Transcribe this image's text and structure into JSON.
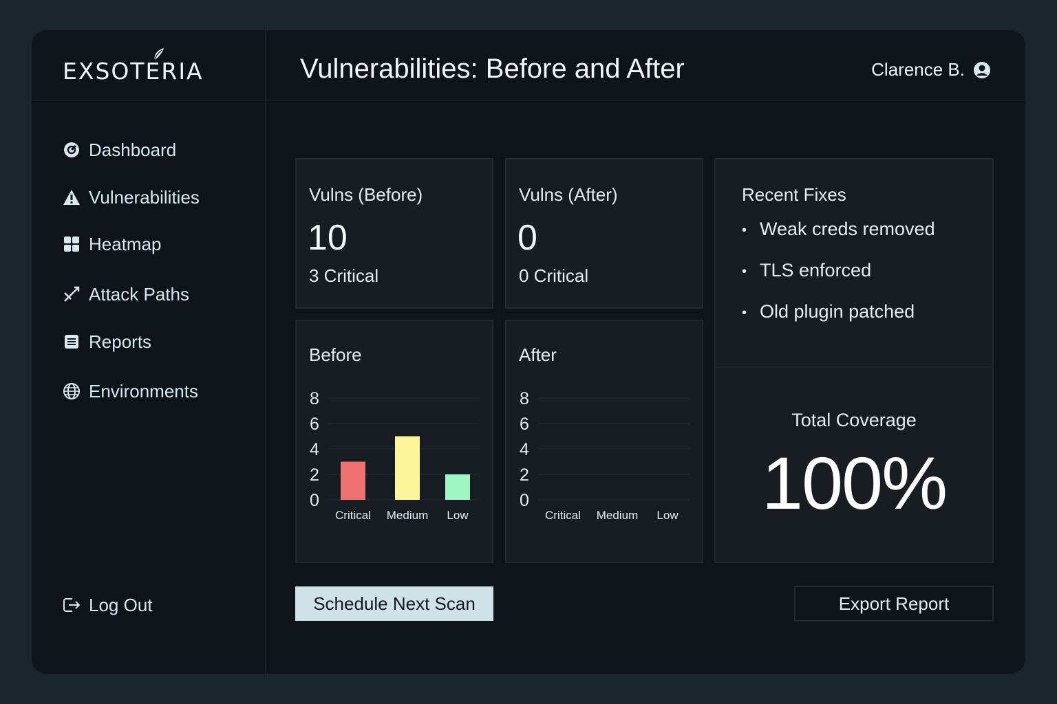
{
  "app": {
    "logo": "EXSOTERIA",
    "title": "Vulnerabilities: Before and After",
    "user": "Clarence B."
  },
  "nav": {
    "items": [
      {
        "label": "Dashboard",
        "icon": "dashboard-icon"
      },
      {
        "label": "Vulnerabilities",
        "icon": "warning-icon"
      },
      {
        "label": "Heatmap",
        "icon": "grid-icon"
      },
      {
        "label": "Attack Paths",
        "icon": "attack-path-icon"
      },
      {
        "label": "Reports",
        "icon": "reports-icon"
      },
      {
        "label": "Environments",
        "icon": "globe-icon"
      }
    ],
    "logout": "Log Out"
  },
  "stats": {
    "before": {
      "title": "Vulns (Before)",
      "count": "10",
      "sub": "3 Critical"
    },
    "after": {
      "title": "Vulns (After)",
      "count": "0",
      "sub": "0 Critical"
    }
  },
  "fixes": {
    "title": "Recent Fixes",
    "items": [
      "Weak creds removed",
      "TLS enforced",
      "Old plugin patched"
    ]
  },
  "coverage": {
    "label": "Total Coverage",
    "value": "100%"
  },
  "colors": {
    "critical": "#f07171",
    "medium": "#fdf59b",
    "low": "#9ef7c3"
  },
  "buttons": {
    "schedule": "Schedule Next Scan",
    "export": "Export Report"
  },
  "chart_data": [
    {
      "type": "bar",
      "title": "Before",
      "categories": [
        "Critical",
        "Medium",
        "Low"
      ],
      "values": [
        3,
        5,
        2
      ],
      "ylim": [
        0,
        8
      ],
      "yticks": [
        0,
        2,
        4,
        6,
        8
      ],
      "grid": true
    },
    {
      "type": "bar",
      "title": "After",
      "categories": [
        "Critical",
        "Medium",
        "Low"
      ],
      "values": [
        0,
        0,
        0
      ],
      "ylim": [
        0,
        8
      ],
      "yticks": [
        0,
        2,
        4,
        6,
        8
      ],
      "grid": true
    }
  ]
}
